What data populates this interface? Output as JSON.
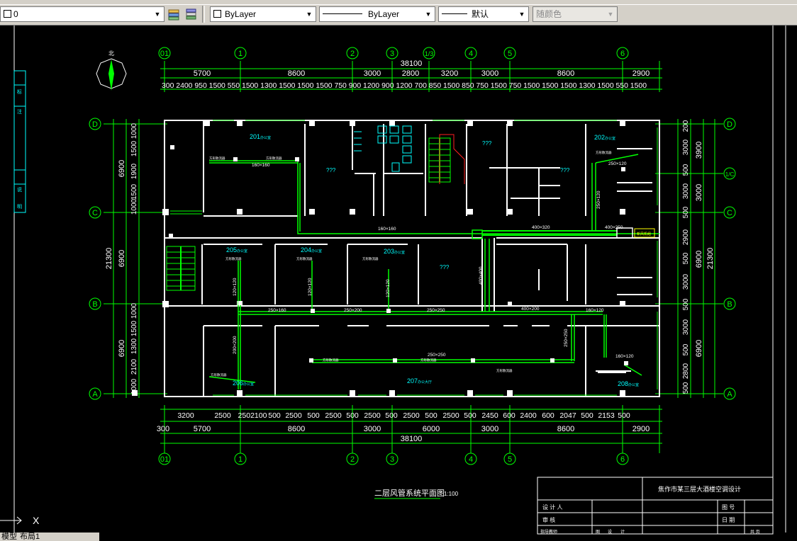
{
  "toolbar": {
    "layer_value": "0",
    "color_value": "ByLayer",
    "linetype_value": "ByLayer",
    "lineweight_value": "默认",
    "plotstyle_value": "随颜色",
    "icons": [
      "layer-manager-icon",
      "layer-previous-icon"
    ]
  },
  "layout_tabs": {
    "model": "模型",
    "layout1": "布局1"
  },
  "drawing": {
    "north_label": "北",
    "title": "二层风管系统平面图",
    "scale": "1:100",
    "grid_top": [
      "01",
      "1",
      "2",
      "3",
      "1/3",
      "4",
      "5",
      "6"
    ],
    "grid_bottom": [
      "01",
      "1",
      "2",
      "3",
      "4",
      "5",
      "6"
    ],
    "grid_left": [
      "D",
      "C",
      "B",
      "A"
    ],
    "grid_right": [
      "D",
      "1/C",
      "C",
      "B",
      "A"
    ],
    "total_top": "38100",
    "total_bottom": "38100",
    "dims_top": [
      "5700",
      "8600",
      "3000",
      "2800",
      "3200",
      "3000",
      "8600",
      "2900"
    ],
    "dims_top_detail": "300 2400  950 1500 550 1500 1300 1500 1500 1500 750 900 1200 900 1200 700 850 1500 850 750 1500 750 1500 1500 1500 1300 1500 550 1500",
    "dims_bottom": [
      "300",
      "5700",
      "8600",
      "3000",
      "6000",
      "3000",
      "8600",
      "2900"
    ],
    "dims_bottom_detail": [
      "3200",
      "2500",
      "2502100",
      "500",
      "2500",
      "500",
      "2500",
      "500",
      "2500",
      "500",
      "2500",
      "500",
      "2500",
      "500",
      "2450",
      "600",
      "2400",
      "600",
      "2047",
      "500",
      "2153",
      "500"
    ],
    "dims_left": [
      "6900",
      "6900",
      "6900",
      "21300"
    ],
    "dims_left_detail": [
      "1000",
      "1500",
      "1900",
      "1500",
      "1000",
      "1000",
      "1500",
      "1300",
      "2100",
      "1000"
    ],
    "dims_right": [
      "3900",
      "3000",
      "6900",
      "6900",
      "21300"
    ],
    "dims_right_detail": [
      "200",
      "3000",
      "500",
      "3000",
      "500",
      "2900",
      "500",
      "3000",
      "500",
      "3000",
      "500",
      "2800",
      "500"
    ],
    "rooms": [
      "201",
      "202",
      "203",
      "204",
      "205",
      "206",
      "207",
      "208"
    ],
    "room_suffix": "办公室",
    "hall_label": "办公大厅",
    "unknown_label": "???",
    "duct_labels": [
      "160×160",
      "160×160",
      "400×320",
      "250×120",
      "250×120",
      "400×250",
      "120×120",
      "120×120",
      "120×120",
      "400×400",
      "250×160",
      "250×200",
      "250×250",
      "400×200",
      "160×120",
      "250×250",
      "200×200",
      "160×120",
      "250×250"
    ],
    "diffuser_label": "方形散流器",
    "unit_label": "新风机组",
    "title_block": {
      "project": "焦作市某三层大酒楼空调设计",
      "row1": "设 计 人",
      "row2": "审 核",
      "row3": "指导教师",
      "right1": "图 号",
      "right2": "日 期",
      "bottom1": "图",
      "bottom2": "设",
      "bottom3": "计",
      "sheet": "共 页"
    },
    "sidebar_labels": [
      "标",
      "注",
      "说",
      "明"
    ],
    "command_prompt": "X"
  },
  "colors": {
    "green": "#00ff00",
    "white": "#ffffff",
    "cyan": "#00ffff",
    "red": "#ff2020",
    "yellow": "#ffff00",
    "toolbar": "#d4d0c8"
  }
}
